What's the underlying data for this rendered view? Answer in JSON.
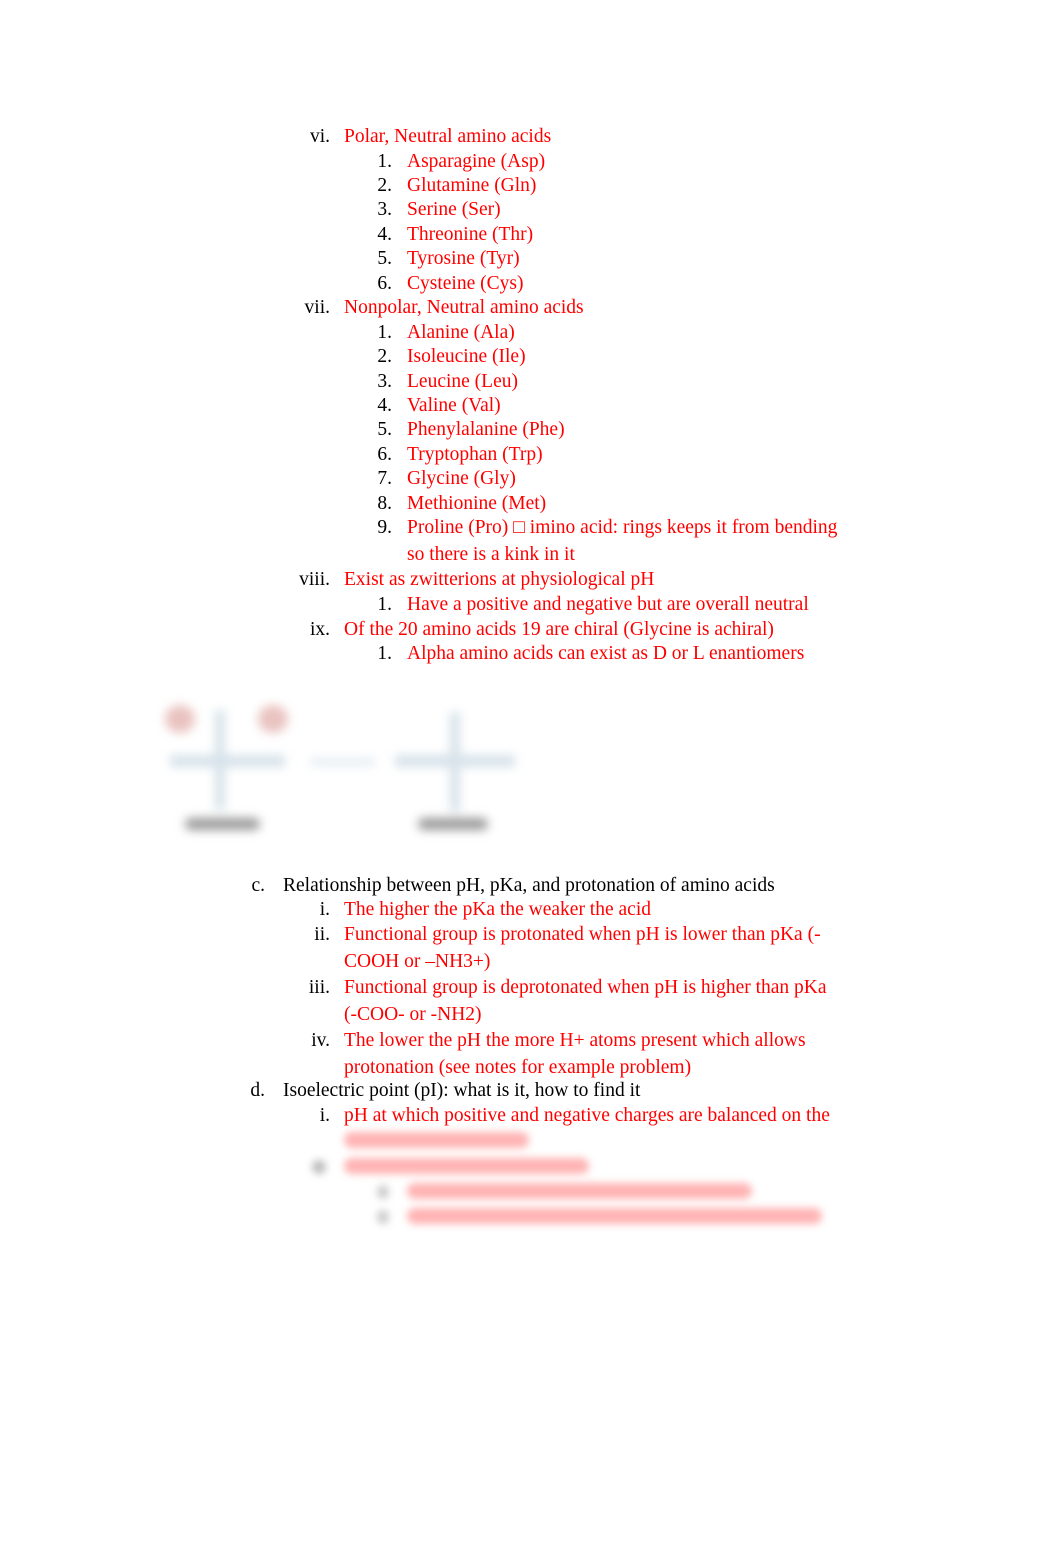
{
  "doc": {
    "vi": {
      "marker": "vi.",
      "title": "Polar, Neutral amino acids",
      "items": [
        {
          "n": "1.",
          "t": "Asparagine (Asp)"
        },
        {
          "n": "2.",
          "t": "Glutamine (Gln)"
        },
        {
          "n": "3.",
          "t": "Serine (Ser)"
        },
        {
          "n": "4.",
          "t": "Threonine (Thr)"
        },
        {
          "n": "5.",
          "t": "Tyrosine (Tyr)"
        },
        {
          "n": "6.",
          "t": "Cysteine (Cys)"
        }
      ]
    },
    "vii": {
      "marker": "vii.",
      "title": "Nonpolar, Neutral amino acids",
      "items": [
        {
          "n": "1.",
          "t": "Alanine (Ala)"
        },
        {
          "n": "2.",
          "t": "Isoleucine (Ile)"
        },
        {
          "n": "3.",
          "t": "Leucine (Leu)"
        },
        {
          "n": "4.",
          "t": "Valine (Val)"
        },
        {
          "n": "5.",
          "t": "Phenylalanine (Phe)"
        },
        {
          "n": "6.",
          "t": "Tryptophan (Trp)"
        },
        {
          "n": "7.",
          "t": "Glycine (Gly)"
        },
        {
          "n": "8.",
          "t": "Methionine (Met)"
        },
        {
          "n": "9.",
          "t": "Proline (Pro)  □  imino acid: rings keeps it from bending",
          "t2": "so there is a kink in it"
        }
      ]
    },
    "viii": {
      "marker": "viii.",
      "title": "Exist as zwitterions at physiological pH",
      "items": [
        {
          "n": "1.",
          "t": "Have a positive and negative but are overall neutral"
        }
      ]
    },
    "ix": {
      "marker": "ix.",
      "title": "Of the 20 amino acids 19 are chiral (Glycine is achiral)",
      "items": [
        {
          "n": "1.",
          "t": "Alpha amino acids can exist as D or L enantiomers"
        }
      ]
    },
    "c": {
      "marker": "c.",
      "title": "Relationship between pH, pKa, and protonation of amino acids",
      "items": [
        {
          "n": "i.",
          "t": "The higher the pKa the weaker the acid"
        },
        {
          "n": "ii.",
          "t": "Functional group is protonated when pH is lower than pKa (-",
          "t2": "COOH or –NH3+)"
        },
        {
          "n": "iii.",
          "t": "Functional group is deprotonated when pH is higher than pKa",
          "t2": "(-COO- or -NH2)"
        },
        {
          "n": "iv.",
          "t": "The lower the pH the more H+ atoms present which allows",
          "t2": "protonation (see notes for example problem)"
        }
      ]
    },
    "d": {
      "marker": "d.",
      "title": "Isoelectric point (pI): what is it, how to find it",
      "items": [
        {
          "n": "i.",
          "t": "pH at which positive and negative charges are balanced on the"
        }
      ]
    },
    "blurred_placeholder": "██████████████"
  }
}
